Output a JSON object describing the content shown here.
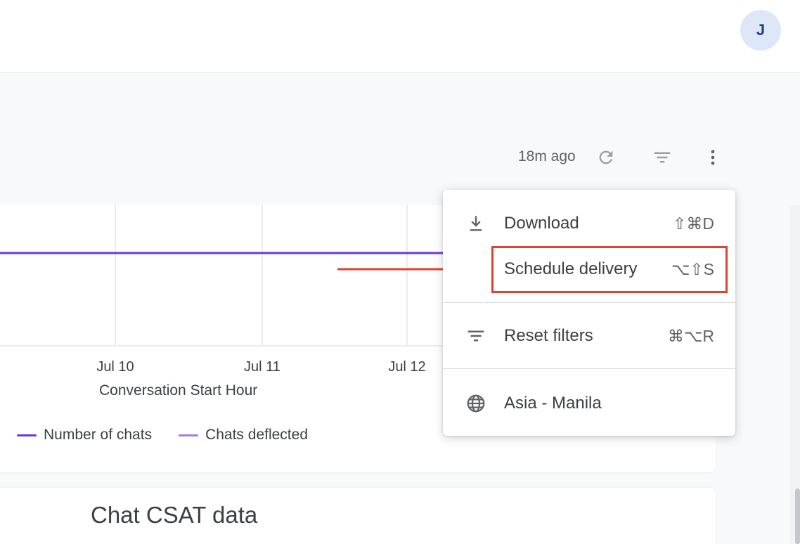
{
  "user": {
    "avatar_initial": "J"
  },
  "header": {
    "last_updated": "18m ago"
  },
  "chart": {
    "x_tick_labels": [
      "Jul 10",
      "Jul 11",
      "Jul 12"
    ],
    "x_axis_title": "Conversation Start Hour",
    "legend": [
      {
        "label": "Number of chats",
        "color": "#6b38e0"
      },
      {
        "label": "Chats deflected",
        "color": "#a47cf0"
      }
    ]
  },
  "next_card": {
    "title": "Chat CSAT data"
  },
  "menu": {
    "items": [
      {
        "label": "Download",
        "shortcut": "⇧⌘D",
        "icon": "download-icon"
      },
      {
        "label": "Schedule delivery",
        "shortcut": "⌥⇧S",
        "icon": "schedule-icon"
      },
      {
        "label": "Reset filters",
        "shortcut": "⌘⌥R",
        "icon": "filter-icon"
      },
      {
        "label": "Asia - Manila",
        "shortcut": "",
        "icon": "globe-icon"
      }
    ]
  },
  "colors": {
    "highlight": "#e0432b",
    "series_primary": "#6b38e0",
    "series_secondary": "#a47cf0"
  }
}
